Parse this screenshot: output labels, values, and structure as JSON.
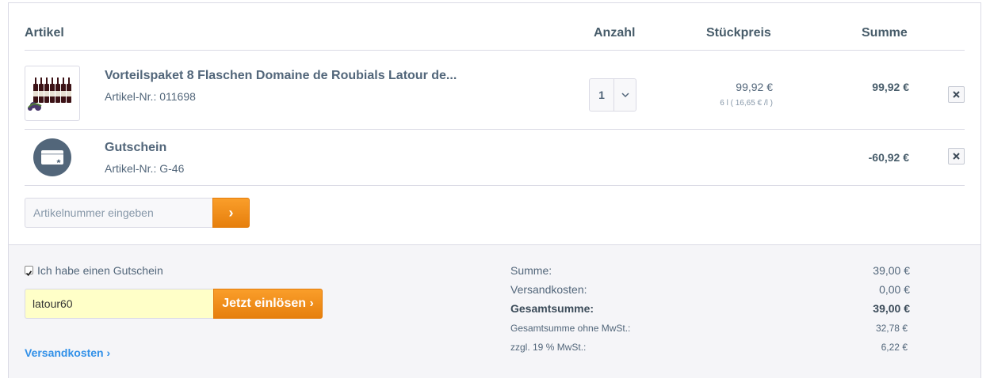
{
  "header": {
    "artikel": "Artikel",
    "anzahl": "Anzahl",
    "stueckpreis": "Stückpreis",
    "summe": "Summe"
  },
  "items": [
    {
      "title": "Vorteilspaket 8 Flaschen Domaine de Roubials Latour de...",
      "sku": "Artikel-Nr.: 011698",
      "quantity": "1",
      "unit_price": "99,92 €",
      "unit_note": "6 l ( 16,65 € /l )",
      "sum": "99,92 €"
    },
    {
      "title": "Gutschein",
      "sku": "Artikel-Nr.: G-46",
      "sum": "-60,92 €"
    }
  ],
  "article_input": {
    "placeholder": "Artikelnummer eingeben",
    "button_glyph": "›"
  },
  "voucher": {
    "checkbox_label": "Ich habe einen Gutschein",
    "checked": true,
    "code_value": "latour60",
    "redeem_label": "Jetzt einlösen ›"
  },
  "shipping_link": "Versandkosten ›",
  "totals": {
    "summe_label": "Summe:",
    "summe_value": "39,00 €",
    "versand_label": "Versandkosten:",
    "versand_value": "0,00 €",
    "gesamt_label": "Gesamtsumme:",
    "gesamt_value": "39,00 €",
    "netto_label": "Gesamtsumme ohne MwSt.:",
    "netto_value": "32,78 €",
    "mwst_label": "zzgl. 19 % MwSt.:",
    "mwst_value": "6,22 €"
  },
  "colors": {
    "accent_orange": "#f59b23",
    "link_blue": "#3190e8",
    "text": "#52667a",
    "voucher_field_bg": "#ffffc8"
  },
  "icons": [
    "wine-bottles-product-image",
    "chevron-down-icon",
    "close-icon",
    "voucher-card-icon",
    "chevron-right-icon",
    "checkbox-checked-icon"
  ]
}
